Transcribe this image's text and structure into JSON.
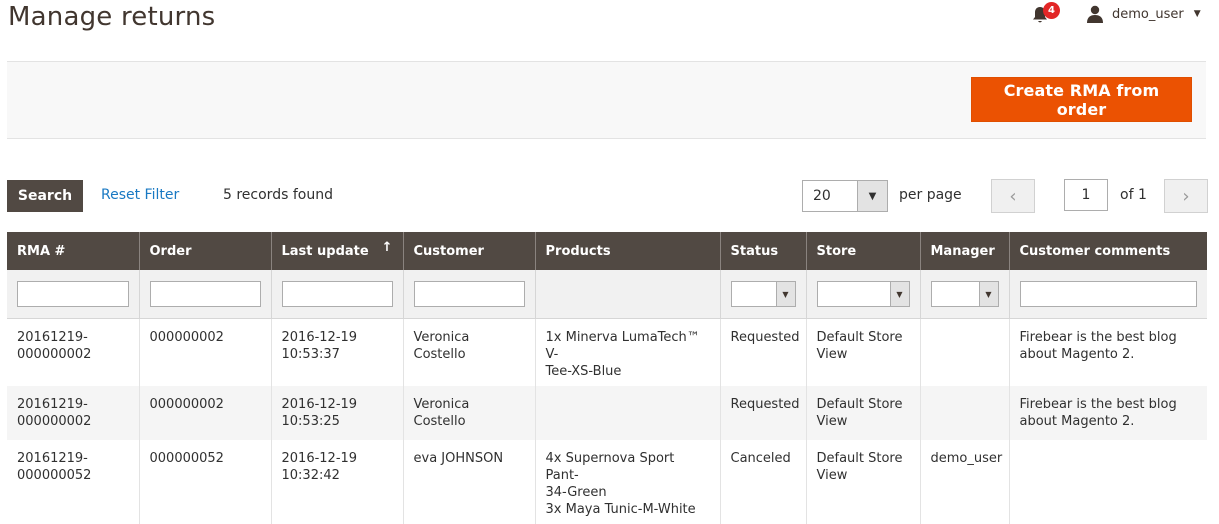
{
  "page": {
    "title": "Manage returns"
  },
  "header": {
    "notifications_count": "4",
    "username": "demo_user"
  },
  "actions": {
    "create_label": "Create RMA from order"
  },
  "toolbar": {
    "search_label": "Search",
    "reset_label": "Reset Filter",
    "records_text": "5 records found",
    "per_page_value": "20",
    "per_page_label": "per page",
    "page_value": "1",
    "page_of": "of 1"
  },
  "columns": [
    "RMA #",
    "Order",
    "Last update",
    "Customer",
    "Products",
    "Status",
    "Store",
    "Manager",
    "Customer comments"
  ],
  "rows": [
    {
      "rma": [
        "20161219-",
        "000000002"
      ],
      "order": "000000002",
      "updated": [
        "2016-12-19",
        "10:53:37"
      ],
      "customer": "Veronica Costello",
      "products": [
        "1x Minerva LumaTech™ V-",
        "Tee-XS-Blue"
      ],
      "status": "Requested",
      "store": [
        "Default Store",
        "View"
      ],
      "manager": "",
      "comments": [
        "Firebear is the best blog",
        "about Magento 2."
      ]
    },
    {
      "rma": [
        "20161219-",
        "000000002"
      ],
      "order": "000000002",
      "updated": [
        "2016-12-19",
        "10:53:25"
      ],
      "customer": "Veronica Costello",
      "products": [
        "",
        ""
      ],
      "status": "Requested",
      "store": [
        "Default Store",
        "View"
      ],
      "manager": "",
      "comments": [
        "Firebear is the best blog",
        "about Magento 2."
      ]
    },
    {
      "rma": [
        "20161219-",
        "000000052"
      ],
      "order": "000000052",
      "updated": [
        "2016-12-19",
        "10:32:42"
      ],
      "customer": "eva JOHNSON",
      "products": [
        "4x Supernova Sport Pant-",
        "34-Green",
        "3x Maya Tunic-M-White"
      ],
      "status": "Canceled",
      "store": [
        "Default Store",
        "View"
      ],
      "manager": "demo_user",
      "comments": [
        "",
        ""
      ]
    }
  ]
}
